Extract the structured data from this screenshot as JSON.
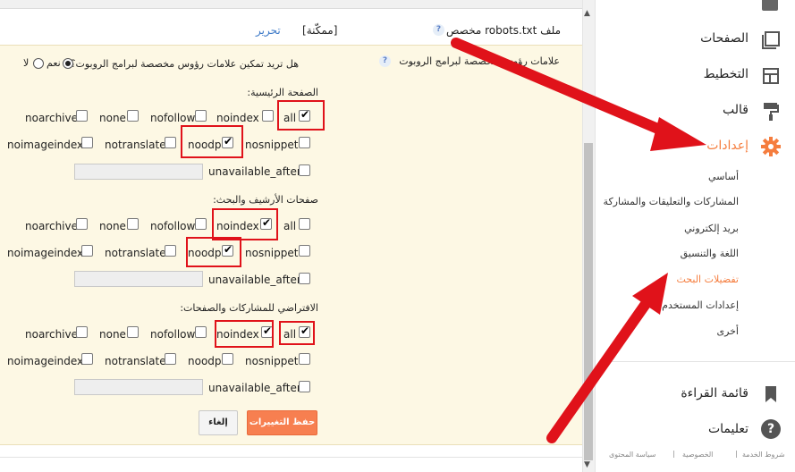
{
  "robots": {
    "label": "ملف robots.txt مخصص",
    "status": "[ممكّنة]",
    "edit": "تحرير"
  },
  "robots_tags": {
    "label": "علامات رؤوس مخصصة لبرامج الروبوت",
    "question": "هل تريد تمكين علامات رؤوس مخصصة لبرامج الروبوت؟",
    "yes": "نعم",
    "no": "لا"
  },
  "home_section": {
    "title": "الصفحة الرئيسية:",
    "row1": [
      "all",
      "noindex",
      "nofollow",
      "none",
      "noarchive"
    ],
    "row2": [
      "nosnippet",
      "noodp",
      "notranslate",
      "noimageindex"
    ],
    "unavailable": "unavailable_after:"
  },
  "archive_section": {
    "title": "صفحات الأرشيف والبحث:",
    "row1": [
      "all",
      "noindex",
      "nofollow",
      "none",
      "noarchive"
    ],
    "row2": [
      "nosnippet",
      "noodp",
      "notranslate",
      "noimageindex"
    ],
    "unavailable": "unavailable_after:"
  },
  "default_section": {
    "title": "الافتراضي للمشاركات والصفحات:",
    "row1": [
      "all",
      "noindex",
      "nofollow",
      "none",
      "noarchive"
    ],
    "row2": [
      "nosnippet",
      "noodp",
      "notranslate",
      "noimageindex"
    ],
    "unavailable": "unavailable_after:"
  },
  "buttons": {
    "save": "حفظ التغييرات",
    "cancel": "إلغاء"
  },
  "sidebar": {
    "nav": [
      {
        "label": "الصفحات",
        "icon": "pages-icon"
      },
      {
        "label": "التخطيط",
        "icon": "layout-icon"
      },
      {
        "label": "قالب",
        "icon": "paint-roller-icon"
      },
      {
        "label": "إعدادات",
        "icon": "gear-icon"
      }
    ],
    "sub": [
      "أساسي",
      "المشاركات والتعليقات والمشاركة",
      "بريد إلكتروني",
      "اللغة والتنسيق",
      "تفضيلات البحث",
      "إعدادات المستخدم",
      "أخرى"
    ],
    "reading_list": "قائمة القراءة",
    "help": "تعليمات",
    "footer": [
      "شروط الخدمة",
      "الخصوصية",
      "سياسة المحتوى"
    ]
  },
  "colors": {
    "accent": "#f57d3e",
    "annotation": "#e0121a",
    "panel": "#fdf8e4"
  }
}
